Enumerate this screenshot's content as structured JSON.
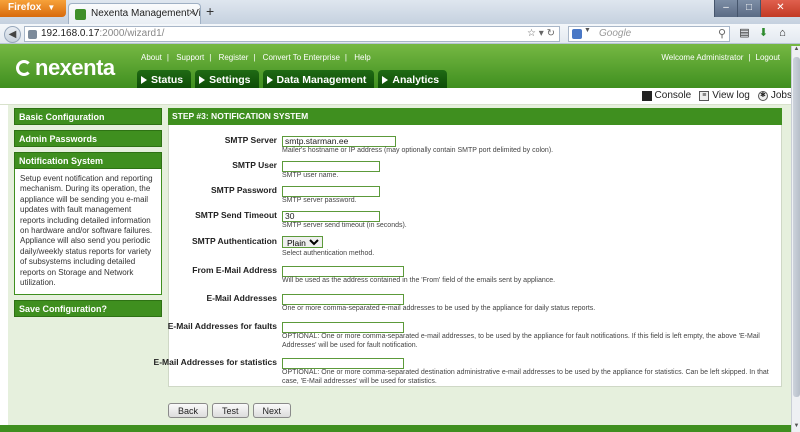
{
  "browser": {
    "app_button": "Firefox",
    "tab_title": "Nexenta Management View: Installation ...",
    "url_host": "192.168.0.17",
    "url_rest": ":2000/wizard1/",
    "search_placeholder": "Google"
  },
  "header": {
    "logo": "nexenta",
    "links": [
      "About",
      "Support",
      "Register",
      "Convert To Enterprise",
      "Help"
    ],
    "welcome": "Welcome Administrator",
    "logout": "Logout",
    "tabs": [
      "Status",
      "Settings",
      "Data Management",
      "Analytics"
    ]
  },
  "tools": {
    "console": "Console",
    "viewlog": "View log",
    "jobs": "Jobs"
  },
  "sidebar": {
    "items": [
      {
        "label": "Basic Configuration"
      },
      {
        "label": "Admin Passwords"
      },
      {
        "label": "Notification System"
      },
      {
        "label": "Save Configuration?"
      }
    ],
    "notification_desc": "Setup event notification and reporting mechanism. During its operation, the appliance will be sending you e-mail updates with fault management reports including detailed information on hardware and/or software failures. Appliance will also send you periodic daily/weekly status reports for variety of subsystems including detailed reports on Storage and Network utilization."
  },
  "step": {
    "title": "STEP #3: NOTIFICATION SYSTEM"
  },
  "form": {
    "smtp_server": {
      "label": "SMTP Server",
      "value": "smtp.starman.ee",
      "help": "Mailer's hostname or IP address (may optionally contain SMTP port delimited by colon)."
    },
    "smtp_user": {
      "label": "SMTP User",
      "value": "",
      "help": "SMTP user name."
    },
    "smtp_password": {
      "label": "SMTP Password",
      "value": "",
      "help": "SMTP server password."
    },
    "smtp_timeout": {
      "label": "SMTP Send Timeout",
      "value": "30",
      "help": "SMTP server send timeout (in seconds)."
    },
    "smtp_auth": {
      "label": "SMTP Authentication",
      "value": "Plain",
      "help": "Select authentication method."
    },
    "from_email": {
      "label": "From E-Mail Address",
      "value": "",
      "help": "Will be used as the address contained in the 'From' field of the emails sent by appliance."
    },
    "emails": {
      "label": "E-Mail Addresses",
      "value": "",
      "help": "One or more comma-separated e-mail addresses to be used by the appliance for daily status reports."
    },
    "emails_faults": {
      "label": "E-Mail Addresses for faults",
      "value": "",
      "help": "OPTIONAL: One or more comma-separated e-mail addresses, to be used by the appliance for fault notifications. If this field is left empty, the above 'E-Mail Addresses' will be used for fault notification."
    },
    "emails_stats": {
      "label": "E-Mail Addresses for statistics",
      "value": "",
      "help": "OPTIONAL: One or more comma-separated destination administrative e-mail addresses to be used by the appliance for statistics. Can be left skipped. In that case, 'E-Mail addresses' will be used for statistics."
    }
  },
  "buttons": {
    "back": "Back",
    "test": "Test",
    "next": "Next"
  }
}
